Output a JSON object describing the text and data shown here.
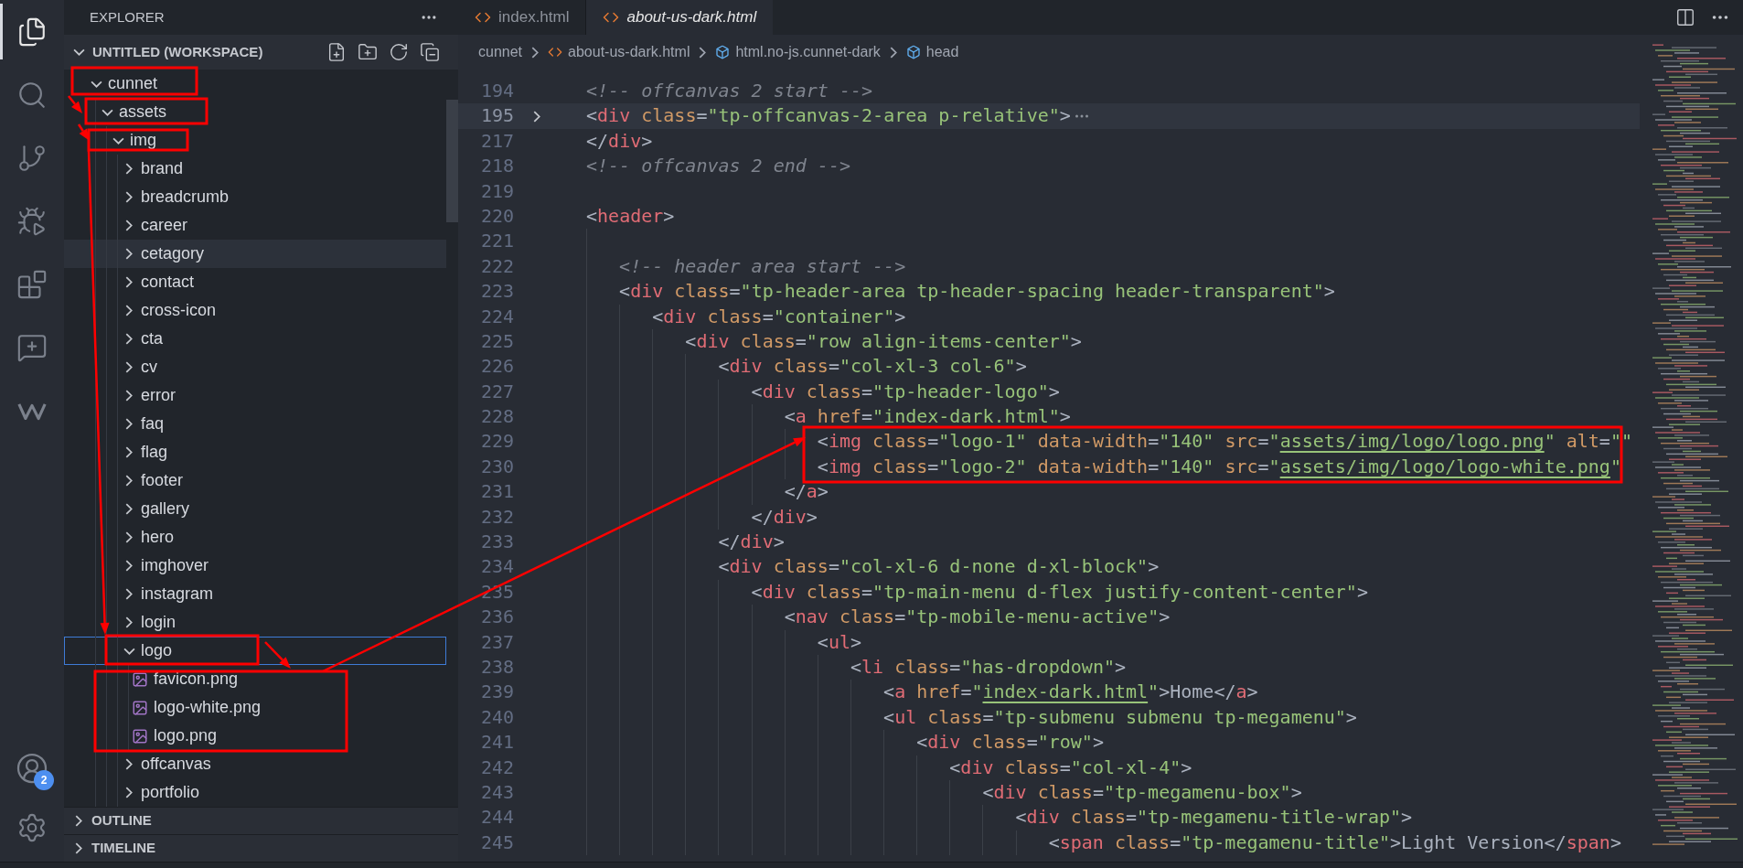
{
  "activity_bar": {
    "items": [
      {
        "kind": "explorer",
        "selected": true
      },
      {
        "kind": "search",
        "selected": false
      },
      {
        "kind": "source_control",
        "selected": false
      },
      {
        "kind": "run",
        "selected": false
      },
      {
        "kind": "extensions",
        "selected": false
      },
      {
        "kind": "chat",
        "selected": false
      },
      {
        "kind": "w",
        "selected": false
      }
    ],
    "account_badge": "2"
  },
  "sidebar": {
    "title": "EXPLORER",
    "workspace": {
      "title": "UNTITLED (WORKSPACE)",
      "expanded": true
    },
    "tree": [
      {
        "name": "cunnet",
        "kind": "folder",
        "expanded": true,
        "selected": false,
        "hovered": false,
        "children": [
          {
            "name": "assets",
            "kind": "folder",
            "expanded": true,
            "selected": false,
            "hovered": false,
            "children": [
              {
                "name": "img",
                "kind": "folder",
                "expanded": true,
                "selected": false,
                "hovered": false,
                "children": [
                  {
                    "name": "brand",
                    "kind": "folder",
                    "expanded": false,
                    "selected": false,
                    "hovered": false
                  },
                  {
                    "name": "breadcrumb",
                    "kind": "folder",
                    "expanded": false,
                    "selected": false,
                    "hovered": false
                  },
                  {
                    "name": "career",
                    "kind": "folder",
                    "expanded": false,
                    "selected": false,
                    "hovered": false
                  },
                  {
                    "name": "cetagory",
                    "kind": "folder",
                    "expanded": false,
                    "selected": false,
                    "hovered": true
                  },
                  {
                    "name": "contact",
                    "kind": "folder",
                    "expanded": false,
                    "selected": false,
                    "hovered": false
                  },
                  {
                    "name": "cross-icon",
                    "kind": "folder",
                    "expanded": false,
                    "selected": false,
                    "hovered": false
                  },
                  {
                    "name": "cta",
                    "kind": "folder",
                    "expanded": false,
                    "selected": false,
                    "hovered": false
                  },
                  {
                    "name": "cv",
                    "kind": "folder",
                    "expanded": false,
                    "selected": false,
                    "hovered": false
                  },
                  {
                    "name": "error",
                    "kind": "folder",
                    "expanded": false,
                    "selected": false,
                    "hovered": false
                  },
                  {
                    "name": "faq",
                    "kind": "folder",
                    "expanded": false,
                    "selected": false,
                    "hovered": false
                  },
                  {
                    "name": "flag",
                    "kind": "folder",
                    "expanded": false,
                    "selected": false,
                    "hovered": false
                  },
                  {
                    "name": "footer",
                    "kind": "folder",
                    "expanded": false,
                    "selected": false,
                    "hovered": false
                  },
                  {
                    "name": "gallery",
                    "kind": "folder",
                    "expanded": false,
                    "selected": false,
                    "hovered": false
                  },
                  {
                    "name": "hero",
                    "kind": "folder",
                    "expanded": false,
                    "selected": false,
                    "hovered": false
                  },
                  {
                    "name": "imghover",
                    "kind": "folder",
                    "expanded": false,
                    "selected": false,
                    "hovered": false
                  },
                  {
                    "name": "instagram",
                    "kind": "folder",
                    "expanded": false,
                    "selected": false,
                    "hovered": false
                  },
                  {
                    "name": "login",
                    "kind": "folder",
                    "expanded": false,
                    "selected": false,
                    "hovered": false
                  },
                  {
                    "name": "logo",
                    "kind": "folder",
                    "expanded": true,
                    "selected": true,
                    "hovered": false,
                    "children": [
                      {
                        "name": "favicon.png",
                        "kind": "image",
                        "selected": false,
                        "hovered": false
                      },
                      {
                        "name": "logo-white.png",
                        "kind": "image",
                        "selected": false,
                        "hovered": false
                      },
                      {
                        "name": "logo.png",
                        "kind": "image",
                        "selected": false,
                        "hovered": false
                      }
                    ]
                  },
                  {
                    "name": "offcanvas",
                    "kind": "folder",
                    "expanded": false,
                    "selected": false,
                    "hovered": false
                  },
                  {
                    "name": "portfolio",
                    "kind": "folder",
                    "expanded": false,
                    "selected": false,
                    "hovered": false
                  }
                ]
              }
            ]
          }
        ]
      }
    ],
    "sections": [
      {
        "title": "OUTLINE",
        "expanded": false
      },
      {
        "title": "TIMELINE",
        "expanded": false
      }
    ]
  },
  "tabs": [
    {
      "label": "index.html",
      "selected": false,
      "preview": false
    },
    {
      "label": "about-us-dark.html",
      "selected": true,
      "preview": true
    }
  ],
  "breadcrumb": [
    {
      "label": "cunnet",
      "kind": "folder"
    },
    {
      "label": "about-us-dark.html",
      "kind": "html"
    },
    {
      "label": "html.no-js.cunnet-dark",
      "kind": "element"
    },
    {
      "label": "head",
      "kind": "element"
    }
  ],
  "code": {
    "lines": [
      {
        "number": "194",
        "text": "<!-- offcanvas 2 start -->",
        "folded": false,
        "current": false
      },
      {
        "number": "195",
        "text": "<div class=\"tp-offcanvas-2-area p-relative\">",
        "folded": true,
        "current": true
      },
      {
        "number": "217",
        "text": "</div>",
        "folded": false,
        "current": false
      },
      {
        "number": "218",
        "text": "<!-- offcanvas 2 end -->",
        "folded": false,
        "current": false
      },
      {
        "number": "219",
        "folded": false,
        "current": false
      },
      {
        "number": "220",
        "text": "<header>",
        "folded": false,
        "current": false
      },
      {
        "number": "221",
        "folded": false,
        "current": false
      },
      {
        "number": "222",
        "text": "   <!-- header area start -->",
        "folded": false,
        "current": false
      },
      {
        "number": "223",
        "text": "   <div class=\"tp-header-area tp-header-spacing header-transparent\">",
        "folded": false,
        "current": false
      },
      {
        "number": "224",
        "text": "      <div class=\"container\">",
        "folded": false,
        "current": false
      },
      {
        "number": "225",
        "text": "         <div class=\"row align-items-center\">",
        "folded": false,
        "current": false
      },
      {
        "number": "226",
        "text": "            <div class=\"col-xl-3 col-6\">",
        "folded": false,
        "current": false
      },
      {
        "number": "227",
        "text": "               <div class=\"tp-header-logo\">",
        "folded": false,
        "current": false
      },
      {
        "number": "228",
        "text": "                  <a href=\"index-dark.html\">",
        "folded": false,
        "current": false
      },
      {
        "number": "229",
        "text": "                     <img class=\"logo-1\" data-width=\"140\" src=\"assets/img/logo/logo.png\" alt=\"\"",
        "folded": false,
        "current": false
      },
      {
        "number": "230",
        "text": "                     <img class=\"logo-2\" data-width=\"140\" src=\"assets/img/logo/logo-white.png\"",
        "folded": false,
        "current": false
      },
      {
        "number": "231",
        "text": "                  </a>",
        "folded": false,
        "current": false
      },
      {
        "number": "232",
        "text": "               </div>",
        "folded": false,
        "current": false
      },
      {
        "number": "233",
        "text": "            </div>",
        "folded": false,
        "current": false
      },
      {
        "number": "234",
        "text": "            <div class=\"col-xl-6 d-none d-xl-block\">",
        "folded": false,
        "current": false
      },
      {
        "number": "235",
        "text": "               <div class=\"tp-main-menu d-flex justify-content-center\">",
        "folded": false,
        "current": false
      },
      {
        "number": "236",
        "text": "                  <nav class=\"tp-mobile-menu-active\">",
        "folded": false,
        "current": false
      },
      {
        "number": "237",
        "text": "                     <ul>",
        "folded": false,
        "current": false
      },
      {
        "number": "238",
        "text": "                        <li class=\"has-dropdown\">",
        "folded": false,
        "current": false
      },
      {
        "number": "239",
        "text": "                           <a href=\"index-dark.html\">Home</a>",
        "folded": false,
        "current": false
      },
      {
        "number": "240",
        "text": "                           <ul class=\"tp-submenu submenu tp-megamenu\">",
        "folded": false,
        "current": false
      },
      {
        "number": "241",
        "text": "                              <div class=\"row\">",
        "folded": false,
        "current": false
      },
      {
        "number": "242",
        "text": "                                 <div class=\"col-xl-4\">",
        "folded": false,
        "current": false
      },
      {
        "number": "243",
        "text": "                                    <div class=\"tp-megamenu-box\">",
        "folded": false,
        "current": false
      },
      {
        "number": "244",
        "text": "                                       <div class=\"tp-megamenu-title-wrap\">",
        "folded": false,
        "current": false
      },
      {
        "number": "245",
        "text": "                                          <span class=\"tp-megamenu-title\">Light Version</span>",
        "folded": false,
        "current": false
      }
    ]
  }
}
